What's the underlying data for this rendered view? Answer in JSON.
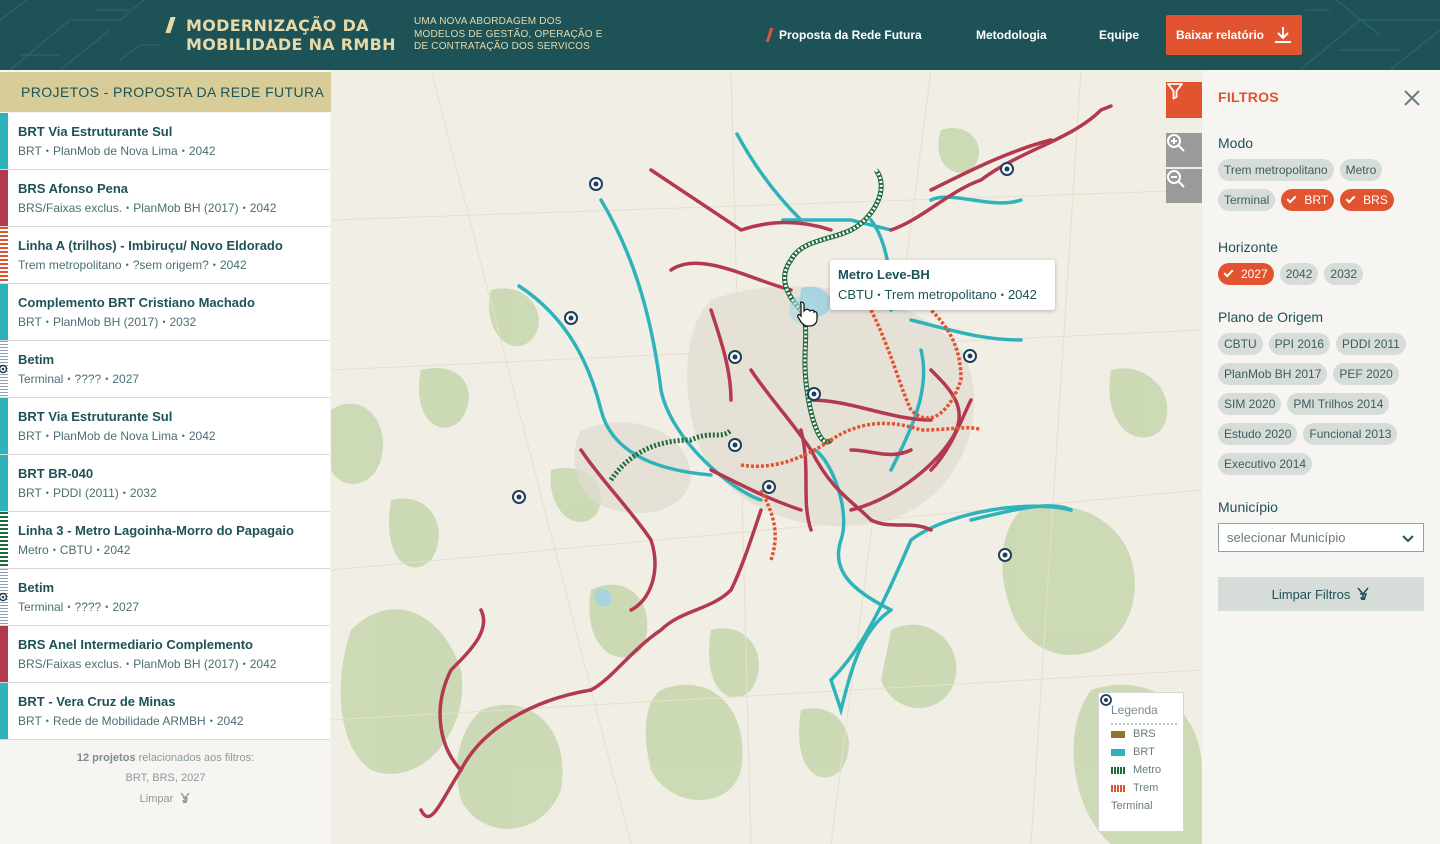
{
  "header": {
    "title": "MODERNIZAÇÃO DA MOBILIDADE NA RMBH",
    "subtitle": "UMA NOVA ABORDAGEM DOS MODELOS DE GESTÃO, OPERAÇÃO E DE CONTRATAÇÃO DOS SERVICOS",
    "nav": {
      "proposta": "Proposta da Rede Futura",
      "metodologia": "Metodologia",
      "equipe": "Equipe"
    },
    "download_label": "Baixar relatório"
  },
  "left_panel": {
    "title": "PROJETOS - PROPOSTA DA REDE FUTURA",
    "projects": [
      {
        "title": "BRT Via Estruturante Sul",
        "mode": "BRT",
        "origin": "PlanMob de Nova Lima",
        "year": "2042",
        "kind": "brt"
      },
      {
        "title": "BRS Afonso Pena",
        "mode": "BRS/Faixas exclus.",
        "origin": "PlanMob BH (2017)",
        "year": "2042",
        "kind": "brs"
      },
      {
        "title": "Linha A (trilhos) - Imbiruçu/ Novo Eldorado",
        "mode": "Trem metropolitano",
        "origin": "?sem origem?",
        "year": "2042",
        "kind": "trem"
      },
      {
        "title": "Complemento BRT Cristiano Machado",
        "mode": "BRT",
        "origin": "PlanMob BH (2017)",
        "year": "2032",
        "kind": "brt"
      },
      {
        "title": "Betim",
        "mode": "Terminal",
        "origin": "????",
        "year": "2027",
        "kind": "terminal"
      },
      {
        "title": "BRT Via Estruturante Sul",
        "mode": "BRT",
        "origin": "PlanMob de Nova Lima",
        "year": "2042",
        "kind": "brt"
      },
      {
        "title": "BRT BR-040",
        "mode": "BRT",
        "origin": "PDDI (2011)",
        "year": "2032",
        "kind": "brt"
      },
      {
        "title": "Linha 3 - Metro Lagoinha-Morro do Papagaio",
        "mode": "Metro",
        "origin": "CBTU",
        "year": "2042",
        "kind": "metro"
      },
      {
        "title": "Betim",
        "mode": "Terminal",
        "origin": "????",
        "year": "2027",
        "kind": "terminal"
      },
      {
        "title": "BRS Anel Intermediario Complemento",
        "mode": "BRS/Faixas exclus.",
        "origin": "PlanMob BH (2017)",
        "year": "2042",
        "kind": "brs"
      },
      {
        "title": "BRT - Vera Cruz de Minas",
        "mode": "BRT",
        "origin": "Rede de Mobilidade ARMBH",
        "year": "2042",
        "kind": "brt"
      }
    ],
    "count_bold": "12 projetos",
    "count_rest": "relacionados aos filtros:",
    "active_filters": "BRT,  BRS,  2027",
    "clear_small": "Limpar"
  },
  "map": {
    "tooltip": {
      "title": "Metro Leve-BH",
      "origin": "CBTU",
      "mode": "Trem metropolitano",
      "year": "2042"
    },
    "legend": {
      "title": "Legenda",
      "items": [
        "BRS",
        "BRT",
        "Metro",
        "Trem",
        "Terminal"
      ]
    }
  },
  "filters": {
    "title": "FILTROS",
    "modo_label": "Modo",
    "modo": [
      {
        "label": "Trem metropolitano",
        "active": false
      },
      {
        "label": "Metro",
        "active": false
      },
      {
        "label": "Terminal",
        "active": false
      },
      {
        "label": "BRT",
        "active": true
      },
      {
        "label": "BRS",
        "active": true
      }
    ],
    "horizonte_label": "Horizonte",
    "horizonte": [
      {
        "label": "2027",
        "active": true
      },
      {
        "label": "2042",
        "active": false
      },
      {
        "label": "2032",
        "active": false
      }
    ],
    "origem_label": "Plano de Origem",
    "origem": [
      {
        "label": "CBTU",
        "active": false
      },
      {
        "label": "PPI 2016",
        "active": false
      },
      {
        "label": "PDDI 2011",
        "active": false
      },
      {
        "label": "PlanMob BH 2017",
        "active": false
      },
      {
        "label": "PEF 2020",
        "active": false
      },
      {
        "label": "SIM 2020",
        "active": false
      },
      {
        "label": "PMI Trilhos 2014",
        "active": false
      },
      {
        "label": "Estudo 2020",
        "active": false
      },
      {
        "label": "Funcional 2013",
        "active": false
      },
      {
        "label": "Executivo 2014",
        "active": false
      }
    ],
    "municipio_label": "Município",
    "municipio_placeholder": "selecionar Município",
    "clear_label": "Limpar Filtros"
  },
  "colors": {
    "header_bg": "#1d5257",
    "accent": "#e2532f",
    "brt": "#2fb3bb",
    "brs": "#b3394f",
    "metro": "#1f6b3b",
    "trem": "#e2532f",
    "brs_legend": "#8c7a2a"
  }
}
